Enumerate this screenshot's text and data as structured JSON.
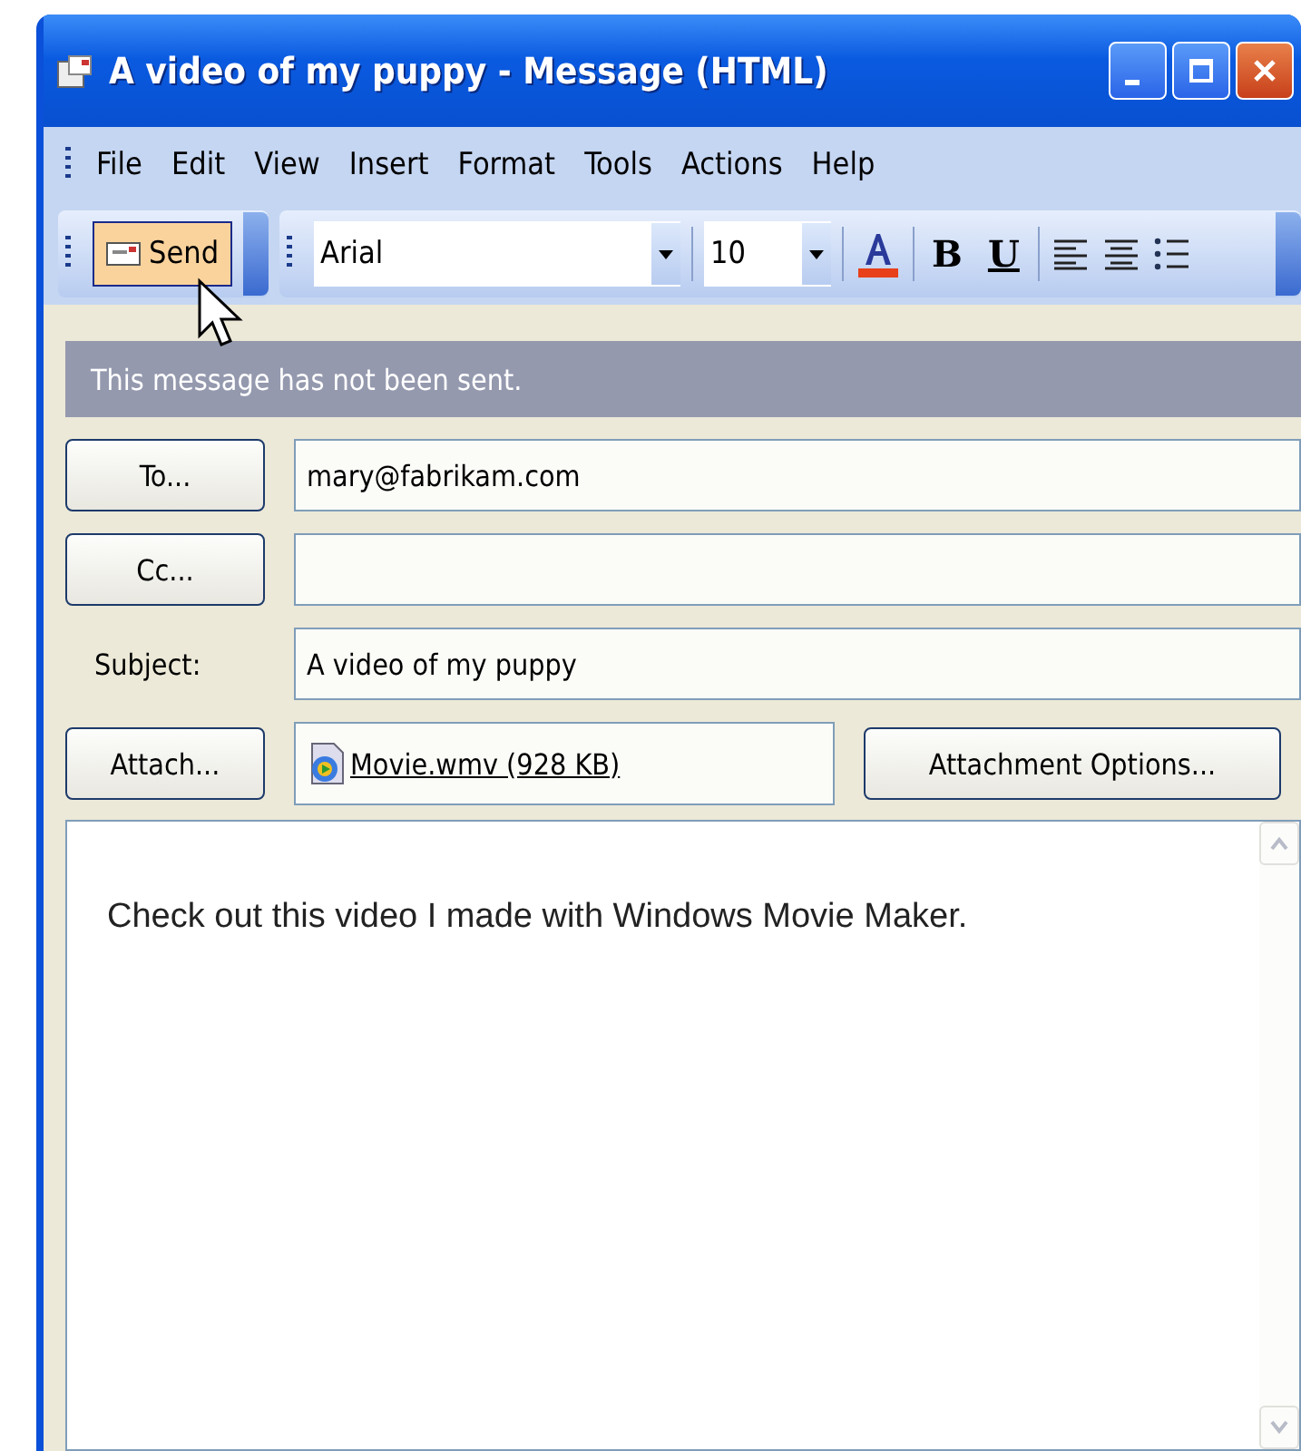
{
  "window": {
    "title": "A video of my puppy - Message (HTML)"
  },
  "menu": [
    {
      "label": "File"
    },
    {
      "label": "Edit"
    },
    {
      "label": "View"
    },
    {
      "label": "Insert"
    },
    {
      "label": "Format"
    },
    {
      "label": "Tools"
    },
    {
      "label": "Actions"
    },
    {
      "label": "Help"
    }
  ],
  "toolbar": {
    "send": {
      "label": "Send",
      "hovered": true
    },
    "font": "Arial",
    "size": "10",
    "bold": "B",
    "underline": "U"
  },
  "info_bar": "This message has not been sent.",
  "fields": [
    {
      "kind": "button",
      "label": "To...",
      "value": "mary@fabrikam.com"
    },
    {
      "kind": "button",
      "label": "Cc..."
    },
    {
      "kind": "label",
      "label": "Subject:",
      "value": "A video of my puppy"
    }
  ],
  "attach": {
    "button": "Attach...",
    "file": "Movie.wmv (928 KB)",
    "options_button": "Attachment Options..."
  },
  "body": "Check out this video I made with Windows Movie Maker."
}
